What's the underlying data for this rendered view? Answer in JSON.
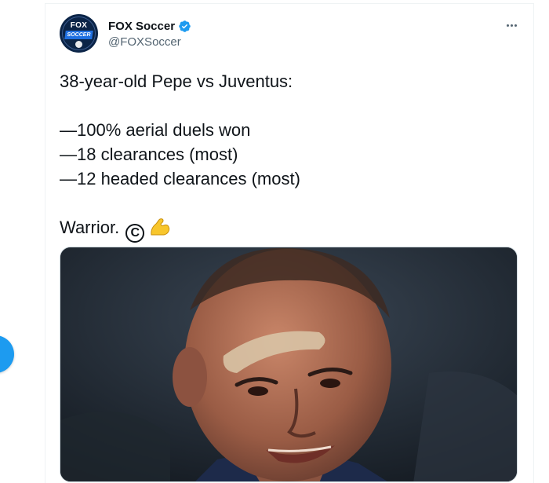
{
  "tweet": {
    "author": {
      "display_name": "FOX Soccer",
      "handle": "@FOXSoccer",
      "verified": true,
      "avatar_logo": {
        "top": "FOX",
        "bottom": "SOCCER"
      }
    },
    "text_lines": [
      "38-year-old Pepe vs Juventus:",
      "",
      "—100% aerial duels won",
      "—18 clearances (most)",
      "—12 headed clearances (most)",
      "",
      "Warrior."
    ],
    "emoji": [
      "copyright-emoji",
      "flexed-biceps-emoji"
    ],
    "more_icon": "more-dots-icon",
    "media": {
      "alt_subject": "player-photo"
    }
  },
  "colors": {
    "accent": "#1d9bf0",
    "text_primary": "#0f1419",
    "text_secondary": "#536471",
    "border": "#eff3f4"
  },
  "compose_button": {
    "icon": "compose-icon"
  }
}
